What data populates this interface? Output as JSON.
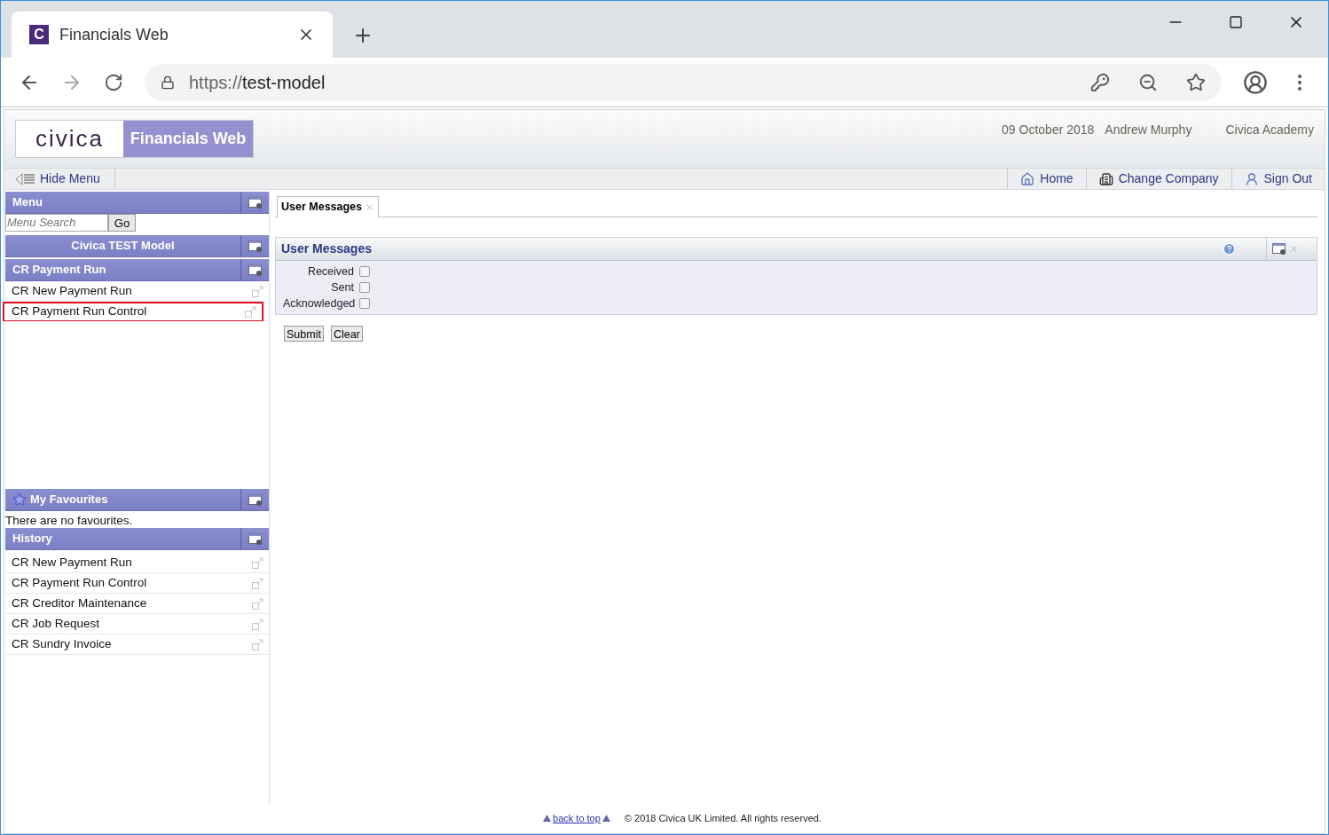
{
  "browser": {
    "tab_title": "Financials Web",
    "tab_logo": "C",
    "url_scheme": "https://",
    "url_host": "test-model"
  },
  "header": {
    "logo": "civica",
    "product": "Financials Web",
    "date": "09 October 2018",
    "user": "Andrew Murphy",
    "company": "Civica Academy"
  },
  "toolbar": {
    "hide_menu": "Hide Menu",
    "links": [
      {
        "kind": "home",
        "label": "Home"
      },
      {
        "kind": "company",
        "label": "Change Company"
      },
      {
        "kind": "signout",
        "label": "Sign Out"
      }
    ]
  },
  "sidebar": {
    "menu_title": "Menu",
    "search_placeholder": "Menu Search",
    "go": "Go",
    "model": "Civica TEST Model",
    "section": "CR Payment Run",
    "items": [
      {
        "label": "CR New Payment Run",
        "highlighted": false
      },
      {
        "label": "CR Payment Run Control",
        "highlighted": true
      }
    ],
    "favourites_title": "My Favourites",
    "favourites_empty": "There are no favourites.",
    "history_title": "History",
    "history": [
      {
        "label": "CR New Payment Run"
      },
      {
        "label": "CR Payment Run Control"
      },
      {
        "label": "CR Creditor Maintenance"
      },
      {
        "label": "CR Job Request"
      },
      {
        "label": "CR Sundry Invoice"
      }
    ]
  },
  "tabs": [
    {
      "label": "User Messages",
      "selected": true
    }
  ],
  "panel": {
    "title": "User Messages",
    "filters": [
      {
        "label": "Received",
        "checked": false
      },
      {
        "label": "Sent",
        "checked": false
      },
      {
        "label": "Acknowledged",
        "checked": false
      }
    ],
    "buttons": [
      "Submit",
      "Clear"
    ]
  },
  "footer": {
    "back_to_top": "back to top",
    "copyright": "© 2018 Civica UK Limited. All rights reserved."
  }
}
